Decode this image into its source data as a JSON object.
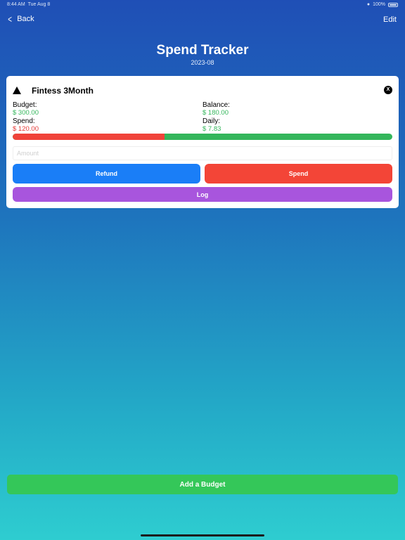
{
  "status_bar": {
    "time": "8:44 AM",
    "date": "Tue Aug 8",
    "battery": "100%"
  },
  "nav": {
    "back_label": "Back",
    "edit_label": "Edit"
  },
  "header": {
    "title": "Spend Tracker",
    "subtitle": "2023-08"
  },
  "budget_card": {
    "name": "Fintess 3Month",
    "close_label": "X",
    "budget_label": "Budget:",
    "budget_value": "$ 300.00",
    "spend_label": "Spend:",
    "spend_value": "$ 120.00",
    "balance_label": "Balance:",
    "balance_value": "$ 180.00",
    "daily_label": "Daily:",
    "daily_value": "$ 7.83",
    "spent_fraction": 0.4,
    "amount_placeholder": "Amount",
    "refund_label": "Refund",
    "spend_button_label": "Spend",
    "log_label": "Log"
  },
  "footer": {
    "add_budget_label": "Add a Budget"
  },
  "colors": {
    "green": "#34b65b",
    "red": "#f34537",
    "blue": "#1a7ef7",
    "purple": "#a855dd",
    "add_green": "#34c759"
  }
}
